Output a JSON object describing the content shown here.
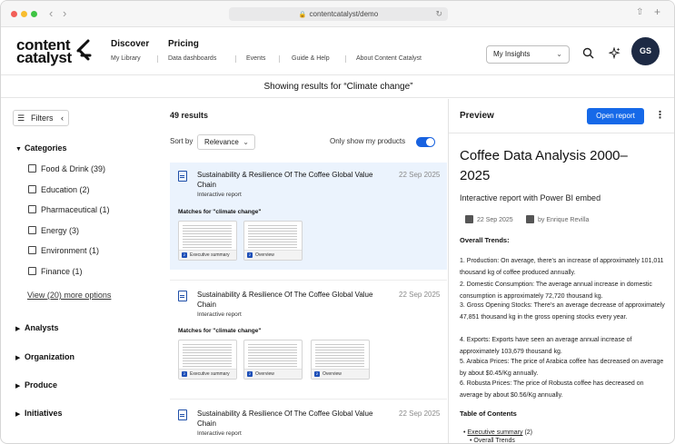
{
  "browser": {
    "url": "contentcatalyst/demo"
  },
  "header": {
    "logo_line1": "content",
    "logo_line2": "catalyst",
    "nav_main": [
      "Discover",
      "Pricing"
    ],
    "nav_sub": [
      "My Library",
      "Data dashboards",
      "Events",
      "Guide & Help",
      "About Content Catalyst"
    ],
    "insights_label": "My Insights",
    "avatar": "GS"
  },
  "banner": "Showing results for “Climate change”",
  "filters": {
    "button": "Filters",
    "categories_title": "Categories",
    "categories": [
      "Food & Drink (39)",
      "Education (2)",
      "Pharmaceutical (1)",
      "Energy (3)",
      "Environment (1)",
      "Finance (1)"
    ],
    "more": "View (20) more options",
    "sections": [
      "Analysts",
      "Organization",
      "Produce",
      "Initiatives"
    ]
  },
  "results": {
    "count": "49 results",
    "sort_label": "Sort by",
    "sort_value": "Relevance",
    "only_mine": "Only show my products",
    "items": [
      {
        "title": "Sustainability & Resilience Of The Coffee Global Value Chain",
        "date": "22 Sep 2025",
        "type": "Interactive report",
        "matches": "Matches for \"climate change\"",
        "thumbs": [
          {
            "n": "2",
            "label": "Executive summary"
          },
          {
            "n": "2",
            "label": "Overview"
          }
        ]
      },
      {
        "title": "Sustainability & Resilience Of The Coffee Global Value Chain",
        "date": "22 Sep 2025",
        "type": "Interactive report",
        "matches": "Matches for \"climate change\"",
        "thumbs": [
          {
            "n": "2",
            "label": "Executive summary"
          },
          {
            "n": "2",
            "label": "Overview"
          },
          {
            "n": "2",
            "label": "Overview"
          }
        ]
      },
      {
        "title": "Sustainability & Resilience Of The Coffee Global Value Chain",
        "date": "22 Sep 2025",
        "type": "Interactive report"
      }
    ]
  },
  "preview": {
    "heading": "Preview",
    "open_button": "Open report",
    "title": "Coffee Data Analysis 2000–2025",
    "subtitle": "Interactive report with Power BI embed",
    "date": "22 Sep 2025",
    "author": "by Enrique Revilla",
    "trends_title": "Overall Trends:",
    "trends": [
      "1. Production: On average, there's an increase of approximately 101,011 thousand kg of coffee produced annually.",
      "2. Domestic Consumption: The average annual increase in domestic consumption is approximately 72,720 thousand kg.",
      "3. Gross Opening Stocks: There's an average decrease of approximately 47,851 thousand kg in the gross opening stocks every year.",
      "4. Exports: Exports have seen an average annual increase of approximately 103,679 thousand kg.",
      "5. Arabica Prices: The price of Arabica coffee has decreased on average by about $0.45/Kg annually.",
      "6. Robusta Prices: The price of Robusta coffee has decreased on average by about $0.56/Kg annually."
    ],
    "toc_title": "Table of Contents",
    "toc": [
      {
        "link": "Executive summary",
        "count": "(2)"
      },
      {
        "link": "Overall Trends",
        "count": ""
      }
    ]
  }
}
